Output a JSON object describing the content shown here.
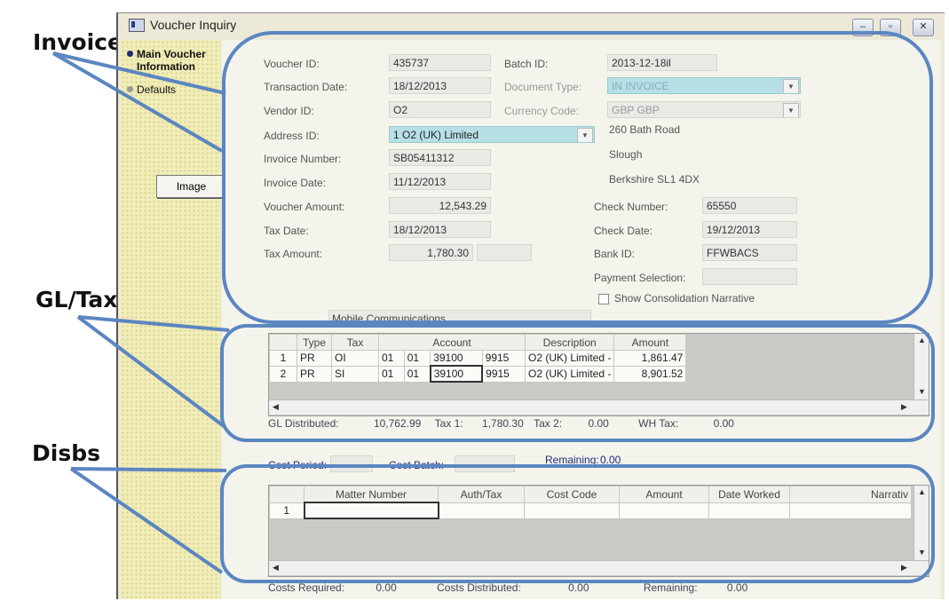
{
  "callouts": {
    "invoice": "Invoice",
    "gltax": "GL/Tax",
    "disbs": "Disbs"
  },
  "window": {
    "title": "Voucher Inquiry",
    "buttons": {
      "minimize": "–",
      "maximize": "▫",
      "close": "✕"
    }
  },
  "sidebar": {
    "items": [
      {
        "label": "Main Voucher",
        "label2": "Information"
      },
      {
        "label": "Defaults"
      }
    ],
    "image_button": "Image"
  },
  "form": {
    "voucher_id": {
      "label": "Voucher ID:",
      "value": "435737"
    },
    "batch_id": {
      "label": "Batch ID:",
      "value": "2013-12-18il"
    },
    "transaction_date": {
      "label": "Transaction Date:",
      "value": "18/12/2013"
    },
    "document_type": {
      "label": "Document Type:",
      "value": "IN  INVOICE"
    },
    "vendor_id": {
      "label": "Vendor ID:",
      "value": "O2"
    },
    "currency_code": {
      "label": "Currency Code:",
      "value": "GBP  GBP"
    },
    "address_id": {
      "label": "Address ID:",
      "value": "1   O2 (UK) Limited"
    },
    "address_lines": [
      "260 Bath Road",
      "Slough",
      "Berkshire  SL1 4DX"
    ],
    "invoice_number": {
      "label": "Invoice Number:",
      "value": "SB05411312"
    },
    "invoice_date": {
      "label": "Invoice Date:",
      "value": "11/12/2013"
    },
    "voucher_amount": {
      "label": "Voucher Amount:",
      "value": "12,543.29"
    },
    "check_number": {
      "label": "Check Number:",
      "value": "65550"
    },
    "tax_date": {
      "label": "Tax Date:",
      "value": "18/12/2013"
    },
    "check_date": {
      "label": "Check Date:",
      "value": "19/12/2013"
    },
    "tax_amount": {
      "label": "Tax Amount:",
      "value": "1,780.30"
    },
    "bank_id": {
      "label": "Bank ID:",
      "value": "FFWBACS"
    },
    "payment_selection": {
      "label": "Payment Selection:",
      "value": ""
    },
    "show_consolidation": {
      "label": "Show Consolidation Narrative"
    },
    "narrative": "Mobile Communications"
  },
  "gl_grid": {
    "headers": [
      "Type",
      "Tax",
      "Account",
      "Description",
      "Amount"
    ],
    "rows": [
      {
        "num": "1",
        "type": "PR",
        "tax": "OI",
        "a1": "01",
        "a2": "01",
        "a3": "39100",
        "a4": "9915",
        "desc": "O2 (UK) Limited -",
        "amount": "1,861.47"
      },
      {
        "num": "2",
        "type": "PR",
        "tax": "SI",
        "a1": "01",
        "a2": "01",
        "a3": "39100",
        "a4": "9915",
        "desc": "O2 (UK) Limited -",
        "amount": "8,901.52"
      }
    ],
    "footer": {
      "gl_distributed_label": "GL Distributed:",
      "gl_distributed": "10,762.99",
      "tax1_label": "Tax 1:",
      "tax1": "1,780.30",
      "tax2_label": "Tax 2:",
      "tax2": "0.00",
      "wh_tax_label": "WH Tax:",
      "wh_tax": "0.00"
    }
  },
  "cost": {
    "period_label": "Cost Period:",
    "batch_label": "Cost Batch:",
    "remaining_label": "Remaining:",
    "remaining": "0.00"
  },
  "disbs_grid": {
    "headers": [
      "Matter Number",
      "Auth/Tax",
      "Cost Code",
      "Amount",
      "Date Worked",
      "Narrativ"
    ],
    "rows": [
      {
        "num": "1"
      }
    ],
    "footer": {
      "costs_required_label": "Costs Required:",
      "costs_required": "0.00",
      "costs_distributed_label": "Costs Distributed:",
      "costs_distributed": "0.00",
      "remaining_label": "Remaining:",
      "remaining": "0.00"
    }
  },
  "colors": {
    "callout": "#5b86c0",
    "teal": "#b7e0e6",
    "sidebar": "#f1edb9"
  }
}
